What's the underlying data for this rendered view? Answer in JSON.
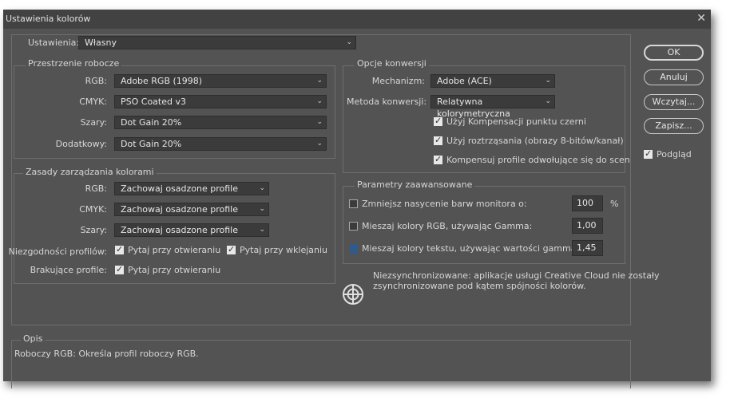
{
  "window": {
    "title": "Ustawienia kolorów"
  },
  "settings": {
    "label": "Ustawienia:",
    "value": "Własny"
  },
  "working_spaces": {
    "legend": "Przestrzenie robocze",
    "rgb_label": "RGB:",
    "rgb_value": "Adobe RGB (1998)",
    "cmyk_label": "CMYK:",
    "cmyk_value": "PSO Coated v3",
    "gray_label": "Szary:",
    "gray_value": "Dot Gain 20%",
    "spot_label": "Dodatkowy:",
    "spot_value": "Dot Gain 20%"
  },
  "policies": {
    "legend": "Zasady zarządzania kolorami",
    "rgb_label": "RGB:",
    "rgb_value": "Zachowaj osadzone profile",
    "cmyk_label": "CMYK:",
    "cmyk_value": "Zachowaj osadzone profile",
    "gray_label": "Szary:",
    "gray_value": "Zachowaj osadzone profile",
    "mismatch_label": "Niezgodności profilów:",
    "mismatch_open": "Pytaj przy otwieraniu",
    "mismatch_paste": "Pytaj przy wklejaniu",
    "missing_label": "Brakujące profile:",
    "missing_open": "Pytaj przy otwieraniu"
  },
  "conversion": {
    "legend": "Opcje konwersji",
    "engine_label": "Mechanizm:",
    "engine_value": "Adobe (ACE)",
    "intent_label": "Metoda konwersji:",
    "intent_value": "Relatywna kolorymetryczna",
    "bpc": "Użyj Kompensacji punktu czerni",
    "dither": "Użyj roztrząsania (obrazy 8-bitów/kanał)",
    "compensate": "Kompensuj profile odwołujące się do scen"
  },
  "advanced": {
    "legend": "Parametry zaawansowane",
    "desaturate": "Zmniejsz nasycenie barw monitora o:",
    "desaturate_value": "100",
    "desaturate_unit": "%",
    "blend_rgb": "Mieszaj kolory RGB, używając Gamma:",
    "blend_rgb_value": "1,00",
    "blend_text": "Mieszaj kolory tekstu, używając wartości gamma:",
    "blend_text_value": "1,45"
  },
  "sync": {
    "line1": "Niezsynchronizowane: aplikacje usługi Creative Cloud nie zostały",
    "line2": "zsynchronizowane pod kątem spójności kolorów."
  },
  "description": {
    "legend": "Opis",
    "text": "Roboczy RGB:  Określa profil roboczy RGB."
  },
  "buttons": {
    "ok": "OK",
    "cancel": "Anuluj",
    "load": "Wczytaj...",
    "save": "Zapisz...",
    "preview": "Podgląd"
  }
}
